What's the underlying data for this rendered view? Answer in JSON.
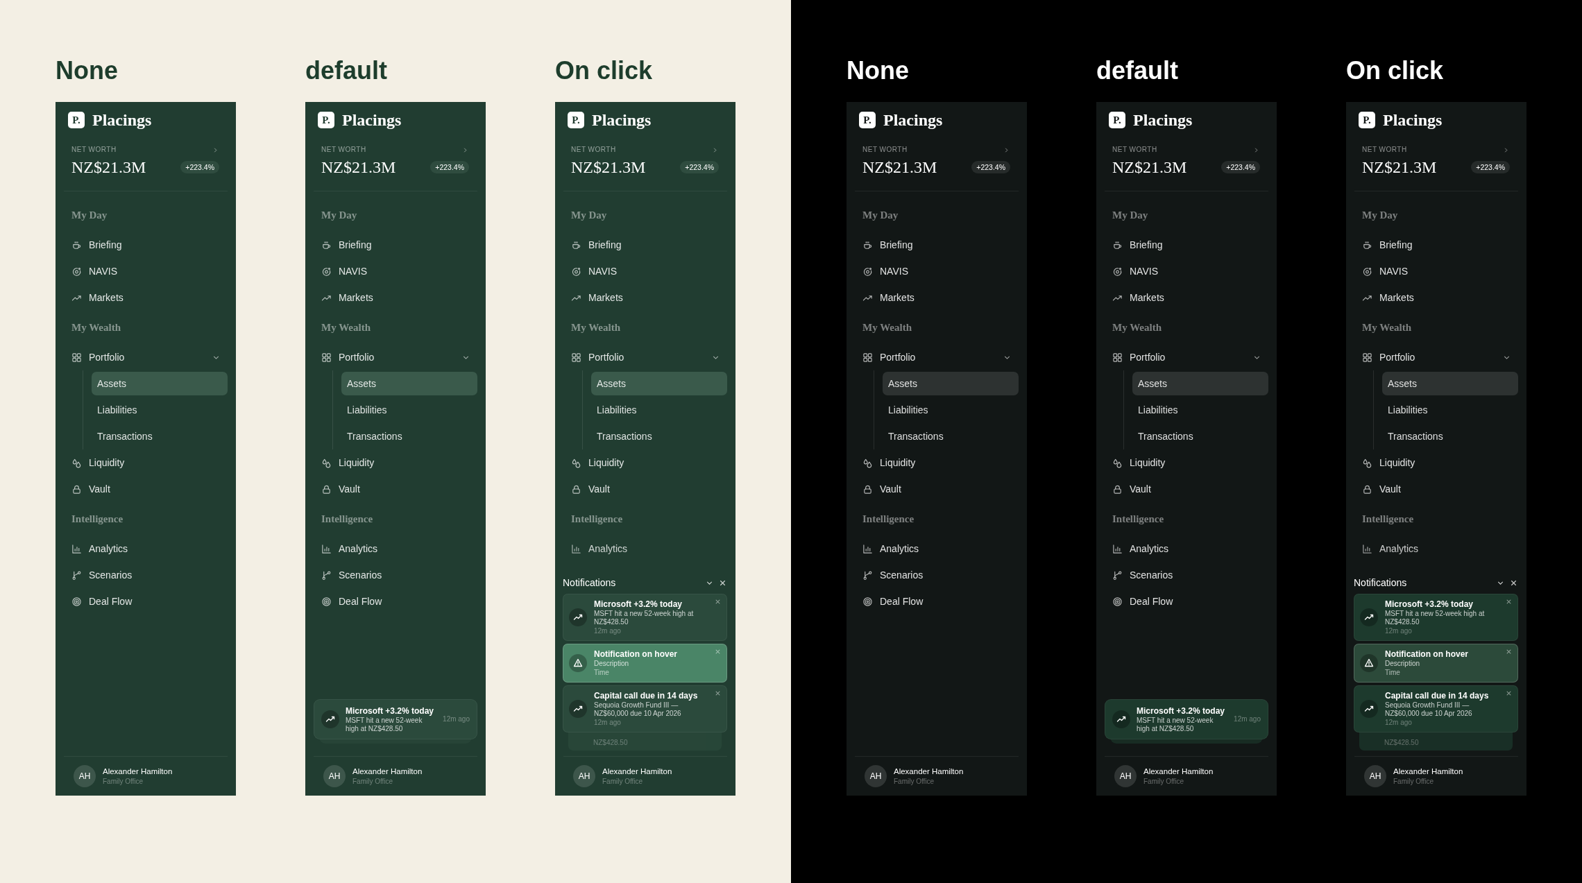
{
  "themes": [
    {
      "kind": "light",
      "boards": [
        {
          "heading": "None",
          "logo": "P.",
          "brand": "Placings",
          "net_worth": {
            "label": "NET WORTH",
            "value": "NZ$21.3M",
            "change": "+223.4%"
          },
          "sections": [
            {
              "title": "My Day",
              "items": [
                {
                  "label": "Briefing",
                  "selected": false
                },
                {
                  "label": "NAVIS",
                  "selected": false
                },
                {
                  "label": "Markets",
                  "selected": false
                }
              ]
            },
            {
              "title": "My Wealth",
              "items": [
                {
                  "label": "Portfolio",
                  "selected": false,
                  "expanded": true,
                  "children": [
                    {
                      "label": "Assets",
                      "selected": true
                    },
                    {
                      "label": "Liabilities",
                      "selected": false
                    },
                    {
                      "label": "Transactions",
                      "selected": false
                    }
                  ]
                },
                {
                  "label": "Liquidity",
                  "selected": false
                },
                {
                  "label": "Vault",
                  "selected": false
                }
              ]
            },
            {
              "title": "Intelligence",
              "items": [
                {
                  "label": "Analytics",
                  "selected": false
                },
                {
                  "label": "Scenarios",
                  "selected": false
                },
                {
                  "label": "Deal Flow",
                  "selected": false
                }
              ]
            }
          ],
          "user": {
            "initials": "AH",
            "name": "Alexander Hamilton",
            "role": "Family Office"
          }
        },
        {
          "heading": "default",
          "logo": "P.",
          "brand": "Placings",
          "net_worth": {
            "label": "NET WORTH",
            "value": "NZ$21.3M",
            "change": "+223.4%"
          },
          "sections": [
            {
              "title": "My Day",
              "items": [
                {
                  "label": "Briefing",
                  "selected": false
                },
                {
                  "label": "NAVIS",
                  "selected": false
                },
                {
                  "label": "Markets",
                  "selected": false
                }
              ]
            },
            {
              "title": "My Wealth",
              "items": [
                {
                  "label": "Portfolio",
                  "selected": false,
                  "expanded": true,
                  "children": [
                    {
                      "label": "Assets",
                      "selected": true
                    },
                    {
                      "label": "Liabilities",
                      "selected": false
                    },
                    {
                      "label": "Transactions",
                      "selected": false
                    }
                  ]
                },
                {
                  "label": "Liquidity",
                  "selected": false
                },
                {
                  "label": "Vault",
                  "selected": false
                }
              ]
            },
            {
              "title": "Intelligence",
              "items": [
                {
                  "label": "Analytics",
                  "selected": false
                },
                {
                  "label": "Scenarios",
                  "selected": false
                },
                {
                  "label": "Deal Flow",
                  "selected": false
                }
              ]
            }
          ],
          "toast": {
            "title": "Microsoft +3.2% today",
            "body": "MSFT hit a new 52-week high at NZ$428.50",
            "time": "12m ago"
          },
          "user": {
            "initials": "AH",
            "name": "Alexander Hamilton",
            "role": "Family Office"
          }
        },
        {
          "heading": "On click",
          "logo": "P.",
          "brand": "Placings",
          "net_worth": {
            "label": "NET WORTH",
            "value": "NZ$21.3M",
            "change": "+223.4%"
          },
          "sections": [
            {
              "title": "My Day",
              "items": [
                {
                  "label": "Briefing",
                  "selected": false
                },
                {
                  "label": "NAVIS",
                  "selected": false
                },
                {
                  "label": "Markets",
                  "selected": false
                }
              ]
            },
            {
              "title": "My Wealth",
              "items": [
                {
                  "label": "Portfolio",
                  "selected": false,
                  "expanded": true,
                  "children": [
                    {
                      "label": "Assets",
                      "selected": true
                    },
                    {
                      "label": "Liabilities",
                      "selected": false
                    },
                    {
                      "label": "Transactions",
                      "selected": false
                    }
                  ]
                },
                {
                  "label": "Liquidity",
                  "selected": false
                },
                {
                  "label": "Vault",
                  "selected": false
                }
              ]
            },
            {
              "title": "Intelligence",
              "items": [
                {
                  "label": "Analytics",
                  "selected": false
                }
              ]
            }
          ],
          "notifications": {
            "title": "Notifications",
            "cards": [
              {
                "kind": "market",
                "title": "Microsoft +3.2% today",
                "body": "MSFT hit a new 52-week high at NZ$428.50",
                "time": "12m ago",
                "hovered": false
              },
              {
                "kind": "alert",
                "title": "Notification on hover",
                "body": "Description",
                "time": "Time",
                "hovered": true
              },
              {
                "kind": "market",
                "title": "Capital call due in 14 days",
                "body": "Sequoia Growth Fund III — NZ$60,000 due 10 Apr 2026",
                "time": "12m ago",
                "hovered": false
              }
            ],
            "stack_peek": "NZ$428.50"
          },
          "user": {
            "initials": "AH",
            "name": "Alexander Hamilton",
            "role": "Family Office"
          }
        }
      ]
    },
    {
      "kind": "dark",
      "boards": [
        {
          "heading": "None",
          "logo": "P.",
          "brand": "Placings",
          "net_worth": {
            "label": "NET WORTH",
            "value": "NZ$21.3M",
            "change": "+223.4%"
          },
          "sections": [
            {
              "title": "My Day",
              "items": [
                {
                  "label": "Briefing",
                  "selected": false
                },
                {
                  "label": "NAVIS",
                  "selected": false
                },
                {
                  "label": "Markets",
                  "selected": false
                }
              ]
            },
            {
              "title": "My Wealth",
              "items": [
                {
                  "label": "Portfolio",
                  "selected": false,
                  "expanded": true,
                  "children": [
                    {
                      "label": "Assets",
                      "selected": true
                    },
                    {
                      "label": "Liabilities",
                      "selected": false
                    },
                    {
                      "label": "Transactions",
                      "selected": false
                    }
                  ]
                },
                {
                  "label": "Liquidity",
                  "selected": false
                },
                {
                  "label": "Vault",
                  "selected": false
                }
              ]
            },
            {
              "title": "Intelligence",
              "items": [
                {
                  "label": "Analytics",
                  "selected": false
                },
                {
                  "label": "Scenarios",
                  "selected": false
                },
                {
                  "label": "Deal Flow",
                  "selected": false
                }
              ]
            }
          ],
          "user": {
            "initials": "AH",
            "name": "Alexander Hamilton",
            "role": "Family Office"
          }
        },
        {
          "heading": "default",
          "logo": "P.",
          "brand": "Placings",
          "net_worth": {
            "label": "NET WORTH",
            "value": "NZ$21.3M",
            "change": "+223.4%"
          },
          "sections": [
            {
              "title": "My Day",
              "items": [
                {
                  "label": "Briefing",
                  "selected": false
                },
                {
                  "label": "NAVIS",
                  "selected": false
                },
                {
                  "label": "Markets",
                  "selected": false
                }
              ]
            },
            {
              "title": "My Wealth",
              "items": [
                {
                  "label": "Portfolio",
                  "selected": false,
                  "expanded": true,
                  "children": [
                    {
                      "label": "Assets",
                      "selected": true
                    },
                    {
                      "label": "Liabilities",
                      "selected": false
                    },
                    {
                      "label": "Transactions",
                      "selected": false
                    }
                  ]
                },
                {
                  "label": "Liquidity",
                  "selected": false
                },
                {
                  "label": "Vault",
                  "selected": false
                }
              ]
            },
            {
              "title": "Intelligence",
              "items": [
                {
                  "label": "Analytics",
                  "selected": false
                },
                {
                  "label": "Scenarios",
                  "selected": false
                },
                {
                  "label": "Deal Flow",
                  "selected": false
                }
              ]
            }
          ],
          "toast": {
            "title": "Microsoft +3.2% today",
            "body": "MSFT hit a new 52-week high at NZ$428.50",
            "time": "12m ago"
          },
          "user": {
            "initials": "AH",
            "name": "Alexander Hamilton",
            "role": "Family Office"
          }
        },
        {
          "heading": "On click",
          "logo": "P.",
          "brand": "Placings",
          "net_worth": {
            "label": "NET WORTH",
            "value": "NZ$21.3M",
            "change": "+223.4%"
          },
          "sections": [
            {
              "title": "My Day",
              "items": [
                {
                  "label": "Briefing",
                  "selected": false
                },
                {
                  "label": "NAVIS",
                  "selected": false
                },
                {
                  "label": "Markets",
                  "selected": false
                }
              ]
            },
            {
              "title": "My Wealth",
              "items": [
                {
                  "label": "Portfolio",
                  "selected": false,
                  "expanded": true,
                  "children": [
                    {
                      "label": "Assets",
                      "selected": true
                    },
                    {
                      "label": "Liabilities",
                      "selected": false
                    },
                    {
                      "label": "Transactions",
                      "selected": false
                    }
                  ]
                },
                {
                  "label": "Liquidity",
                  "selected": false
                },
                {
                  "label": "Vault",
                  "selected": false
                }
              ]
            },
            {
              "title": "Intelligence",
              "items": [
                {
                  "label": "Analytics",
                  "selected": false
                }
              ]
            }
          ],
          "notifications": {
            "title": "Notifications",
            "cards": [
              {
                "kind": "market",
                "title": "Microsoft +3.2% today",
                "body": "MSFT hit a new 52-week high at NZ$428.50",
                "time": "12m ago",
                "hovered": false
              },
              {
                "kind": "alert",
                "title": "Notification on hover",
                "body": "Description",
                "time": "Time",
                "hovered": true
              },
              {
                "kind": "market",
                "title": "Capital call due in 14 days",
                "body": "Sequoia Growth Fund III — NZ$60,000 due 10 Apr 2026",
                "time": "12m ago",
                "hovered": false
              }
            ],
            "stack_peek": "NZ$428.50"
          },
          "user": {
            "initials": "AH",
            "name": "Alexander Hamilton",
            "role": "Family Office"
          }
        }
      ]
    }
  ]
}
